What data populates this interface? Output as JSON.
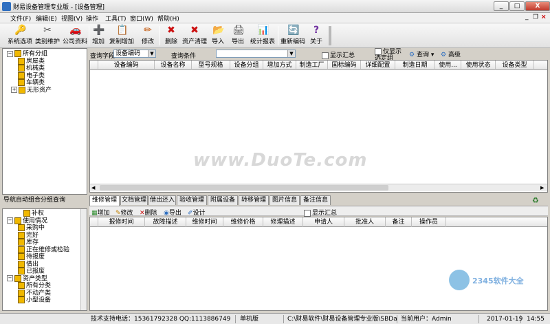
{
  "window": {
    "title": "财易设备管理专业版 - [设备管理]",
    "min_label": "_",
    "max_label": "□",
    "close_label": "X"
  },
  "menu": [
    {
      "label": "文件(F)"
    },
    {
      "label": "编辑(E)"
    },
    {
      "label": "视图(V)"
    },
    {
      "label": "操作"
    },
    {
      "label": "工具(T)"
    },
    {
      "label": "窗口(W)"
    },
    {
      "label": "帮助(H)"
    }
  ],
  "mdi_controls": {
    "min": "_",
    "restore": "❐",
    "close": "×"
  },
  "toolbar": {
    "items": [
      {
        "label": "系统选项",
        "icon": "🔑"
      },
      {
        "label": "类别维护",
        "icon": "✂"
      },
      {
        "label": "公司资料",
        "icon": "🚗"
      },
      {
        "label": "增加",
        "icon": "➕"
      },
      {
        "label": "复制增加",
        "icon": "📋"
      },
      {
        "label": "修改",
        "icon": "✏"
      },
      {
        "label": "删除",
        "icon": "✖"
      },
      {
        "label": "资产清理",
        "icon": "✖"
      },
      {
        "label": "导入",
        "icon": "📂"
      },
      {
        "label": "导出",
        "icon": "🖨"
      },
      {
        "label": "统计报表",
        "icon": "📊"
      },
      {
        "label": "重新编码",
        "icon": "🔄"
      },
      {
        "label": "关于",
        "icon": "?"
      }
    ]
  },
  "tree_top": {
    "items": [
      {
        "label": "所有分组",
        "expander": "−"
      },
      {
        "label": "房屋类"
      },
      {
        "label": "机械类"
      },
      {
        "label": "电子类"
      },
      {
        "label": "车辆类"
      },
      {
        "label": "无形资产",
        "expander": "+"
      }
    ]
  },
  "nav_panel": {
    "title": "导航自动组合分组查询"
  },
  "tree_bottom": {
    "items": [
      {
        "label": "补权"
      },
      {
        "label": "使用情况",
        "expander": "−"
      },
      {
        "label": "采购中"
      },
      {
        "label": "完好"
      },
      {
        "label": "库存"
      },
      {
        "label": "正在维修或检验"
      },
      {
        "label": "待报废"
      },
      {
        "label": "借出"
      },
      {
        "label": "已报废"
      },
      {
        "label": "资产类型",
        "expander": "−"
      },
      {
        "label": "所有分类"
      },
      {
        "label": "不动产类"
      },
      {
        "label": "小型设备"
      }
    ]
  },
  "query": {
    "field_label": "查询字段",
    "field_value": "设备编码",
    "cond_label": "查询条件",
    "cond_value": "",
    "show_summary": "显示汇总",
    "only_show": "仅显示选定组",
    "search_btn": "查询",
    "advanced_btn": "高级"
  },
  "main_grid": {
    "columns": [
      "设备编码",
      "设备名称",
      "型号规格",
      "设备分组",
      "增加方式",
      "制造工厂",
      "国标编码",
      "详细配置",
      "制造日期",
      "使用...",
      "使用状态",
      "设备类型"
    ]
  },
  "watermark": "www.DuoTe.com",
  "tabs": [
    "维修管理",
    "文档管理",
    "借出还入",
    "验收管理",
    "附属设备",
    "转移管理",
    "图片信息",
    "备注信息"
  ],
  "sub_toolbar": {
    "add": "增加",
    "edit": "修改",
    "delete": "删除",
    "export": "导出",
    "design": "设计",
    "show_summary": "显示汇总"
  },
  "sub_grid": {
    "columns": [
      "报修时间",
      "故障描述",
      "维修时间",
      "维修价格",
      "修理描述",
      "申请人",
      "批准人",
      "备注",
      "操作员"
    ]
  },
  "logo": {
    "text": "2345软件大全"
  },
  "status": {
    "support": "技术支持电话：15361792328 QQ:1113886749",
    "mode": "单机版",
    "path": "C:\\财易软件\\财易设备管理专业版\\SBData.sys",
    "user": "当前用户：Admin",
    "date": "2017-01-19",
    "time": "14:55"
  },
  "colors": {
    "accent": "#2f6fc0",
    "tree_icon": "#f0b800",
    "close": "#c0392b"
  }
}
